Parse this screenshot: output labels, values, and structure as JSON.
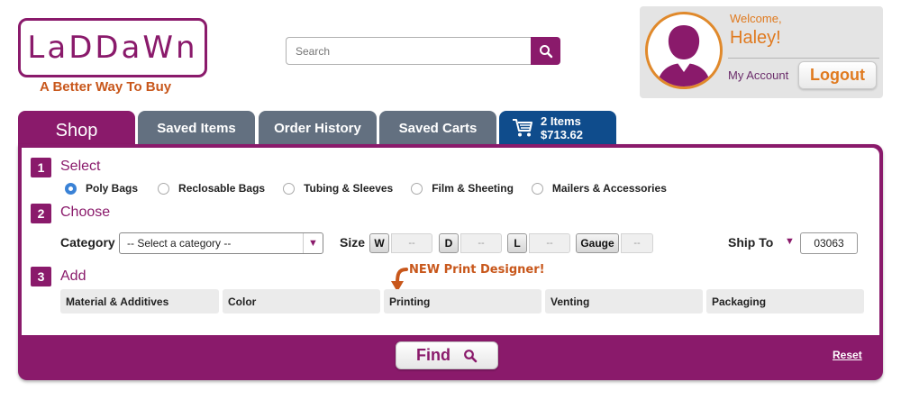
{
  "brand": {
    "logo_text": "LaDDaWn",
    "tagline": "A Better Way To Buy",
    "color": "#8a1a6b",
    "accent": "#e07a1f"
  },
  "search": {
    "placeholder": "Search",
    "icon": "search-icon"
  },
  "account": {
    "welcome": "Welcome,",
    "name": "Haley!",
    "my_account_label": "My Account",
    "logout_label": "Logout"
  },
  "tabs": [
    {
      "label": "Shop",
      "active": true
    },
    {
      "label": "Saved Items",
      "active": false
    },
    {
      "label": "Order History",
      "active": false
    },
    {
      "label": "Saved Carts",
      "active": false
    }
  ],
  "cart": {
    "items": "2 Items",
    "total": "$713.62",
    "icon": "cart-icon"
  },
  "steps": {
    "select": {
      "num": "1",
      "title": "Select"
    },
    "choose": {
      "num": "2",
      "title": "Choose"
    },
    "add": {
      "num": "3",
      "title": "Add"
    }
  },
  "product_types": [
    {
      "label": "Poly Bags",
      "checked": true
    },
    {
      "label": "Reclosable Bags",
      "checked": false
    },
    {
      "label": "Tubing & Sleeves",
      "checked": false
    },
    {
      "label": "Film & Sheeting",
      "checked": false
    },
    {
      "label": "Mailers & Accessories",
      "checked": false
    }
  ],
  "choose": {
    "category_label": "Category",
    "category_value": "-- Select a category --",
    "size_label": "Size",
    "width_key": "W",
    "width_val": "--",
    "depth_key": "D",
    "depth_val": "--",
    "length_key": "L",
    "length_val": "--",
    "gauge_key": "Gauge",
    "gauge_val": "--",
    "ship_label": "Ship To",
    "ship_value": "03063"
  },
  "promo": "NEW Print Designer!",
  "add_options": [
    "Material & Additives",
    "Color",
    "Printing",
    "Venting",
    "Packaging"
  ],
  "actions": {
    "find_label": "Find",
    "reset_label": "Reset"
  }
}
